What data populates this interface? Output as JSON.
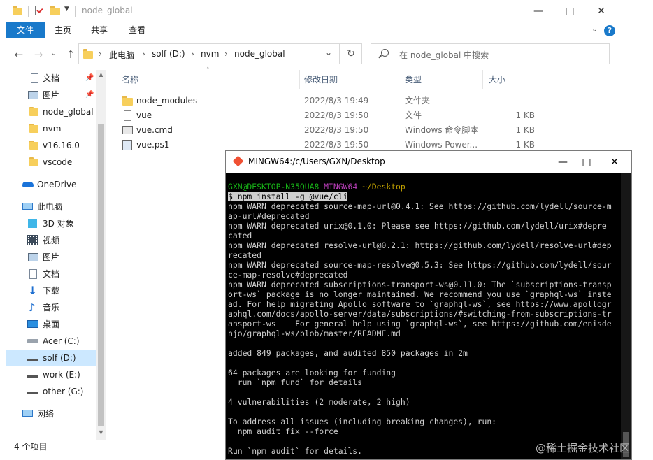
{
  "explorer": {
    "window_title": "node_global",
    "ribbon_tabs": [
      "文件",
      "主页",
      "共享",
      "查看"
    ],
    "address": {
      "crumbs": [
        "此电脑",
        "solf (D:)",
        "nvm",
        "node_global"
      ]
    },
    "search": {
      "placeholder": "在 node_global 中搜索"
    },
    "sidebar": {
      "quick_access": [
        {
          "label": "文档",
          "icon": "document-icon",
          "pinned": true
        },
        {
          "label": "图片",
          "icon": "picture-icon",
          "pinned": true
        },
        {
          "label": "node_global",
          "icon": "folder-icon"
        },
        {
          "label": "nvm",
          "icon": "folder-icon"
        },
        {
          "label": "v16.16.0",
          "icon": "folder-icon"
        },
        {
          "label": "vscode",
          "icon": "folder-icon"
        }
      ],
      "onedrive": "OneDrive",
      "this_pc": "此电脑",
      "pc_items": [
        {
          "label": "3D 对象",
          "icon": "cube-icon"
        },
        {
          "label": "视频",
          "icon": "video-icon"
        },
        {
          "label": "图片",
          "icon": "picture-icon"
        },
        {
          "label": "文档",
          "icon": "document-icon"
        },
        {
          "label": "下载",
          "icon": "download-icon"
        },
        {
          "label": "音乐",
          "icon": "music-icon"
        },
        {
          "label": "桌面",
          "icon": "desktop-icon"
        },
        {
          "label": "Acer (C:)",
          "icon": "drive-icon"
        },
        {
          "label": "solf (D:)",
          "icon": "drive-icon",
          "selected": true
        },
        {
          "label": "work (E:)",
          "icon": "drive-icon"
        },
        {
          "label": "other (G:)",
          "icon": "drive-icon"
        }
      ],
      "network": "网络"
    },
    "columns": {
      "name": "名称",
      "date": "修改日期",
      "type": "类型",
      "size": "大小"
    },
    "files": [
      {
        "name": "node_modules",
        "date": "2022/8/3 19:49",
        "type": "文件夹",
        "size": "",
        "icon": "folder-icon"
      },
      {
        "name": "vue",
        "date": "2022/8/3 19:50",
        "type": "文件",
        "size": "1 KB",
        "icon": "file-icon"
      },
      {
        "name": "vue.cmd",
        "date": "2022/8/3 19:50",
        "type": "Windows 命令脚本",
        "size": "1 KB",
        "icon": "cmd-file-icon"
      },
      {
        "name": "vue.ps1",
        "date": "2022/8/3 19:50",
        "type": "Windows Power...",
        "size": "1 KB",
        "icon": "powershell-file-icon"
      }
    ],
    "status": "4 个项目"
  },
  "terminal": {
    "title": "MINGW64:/c/Users/GXN/Desktop",
    "prompt_user": "GXN@DESKTOP-N35QUA8",
    "prompt_env": "MINGW64",
    "prompt_path": "~/Desktop",
    "command": "$ npm install -g @vue/cli",
    "lines": [
      "npm WARN deprecated source-map-url@0.4.1: See https://github.com/lydell/source-m",
      "ap-url#deprecated",
      "npm WARN deprecated urix@0.1.0: Please see https://github.com/lydell/urix#depre",
      "cated",
      "npm WARN deprecated resolve-url@0.2.1: https://github.com/lydell/resolve-url#dep",
      "recated",
      "npm WARN deprecated source-map-resolve@0.5.3: See https://github.com/lydell/sour",
      "ce-map-resolve#deprecated",
      "npm WARN deprecated subscriptions-transport-ws@0.11.0: The `subscriptions-transp",
      "ort-ws` package is no longer maintained. We recommend you use `graphql-ws` inste",
      "ad. For help migrating Apollo software to `graphql-ws`, see https://www.apollogr",
      "aphql.com/docs/apollo-server/data/subscriptions/#switching-from-subscriptions-tr",
      "ansport-ws    For general help using `graphql-ws`, see https://github.com/enisde",
      "njo/graphql-ws/blob/master/README.md",
      "",
      "added 849 packages, and audited 850 packages in 2m",
      "",
      "64 packages are looking for funding",
      "  run `npm fund` for details",
      "",
      "4 vulnerabilities (2 moderate, 2 high)",
      "",
      "To address all issues (including breaking changes), run:",
      "  npm audit fix --force",
      "",
      "Run `npm audit` for details."
    ]
  },
  "watermark": "@稀土掘金技术社区"
}
